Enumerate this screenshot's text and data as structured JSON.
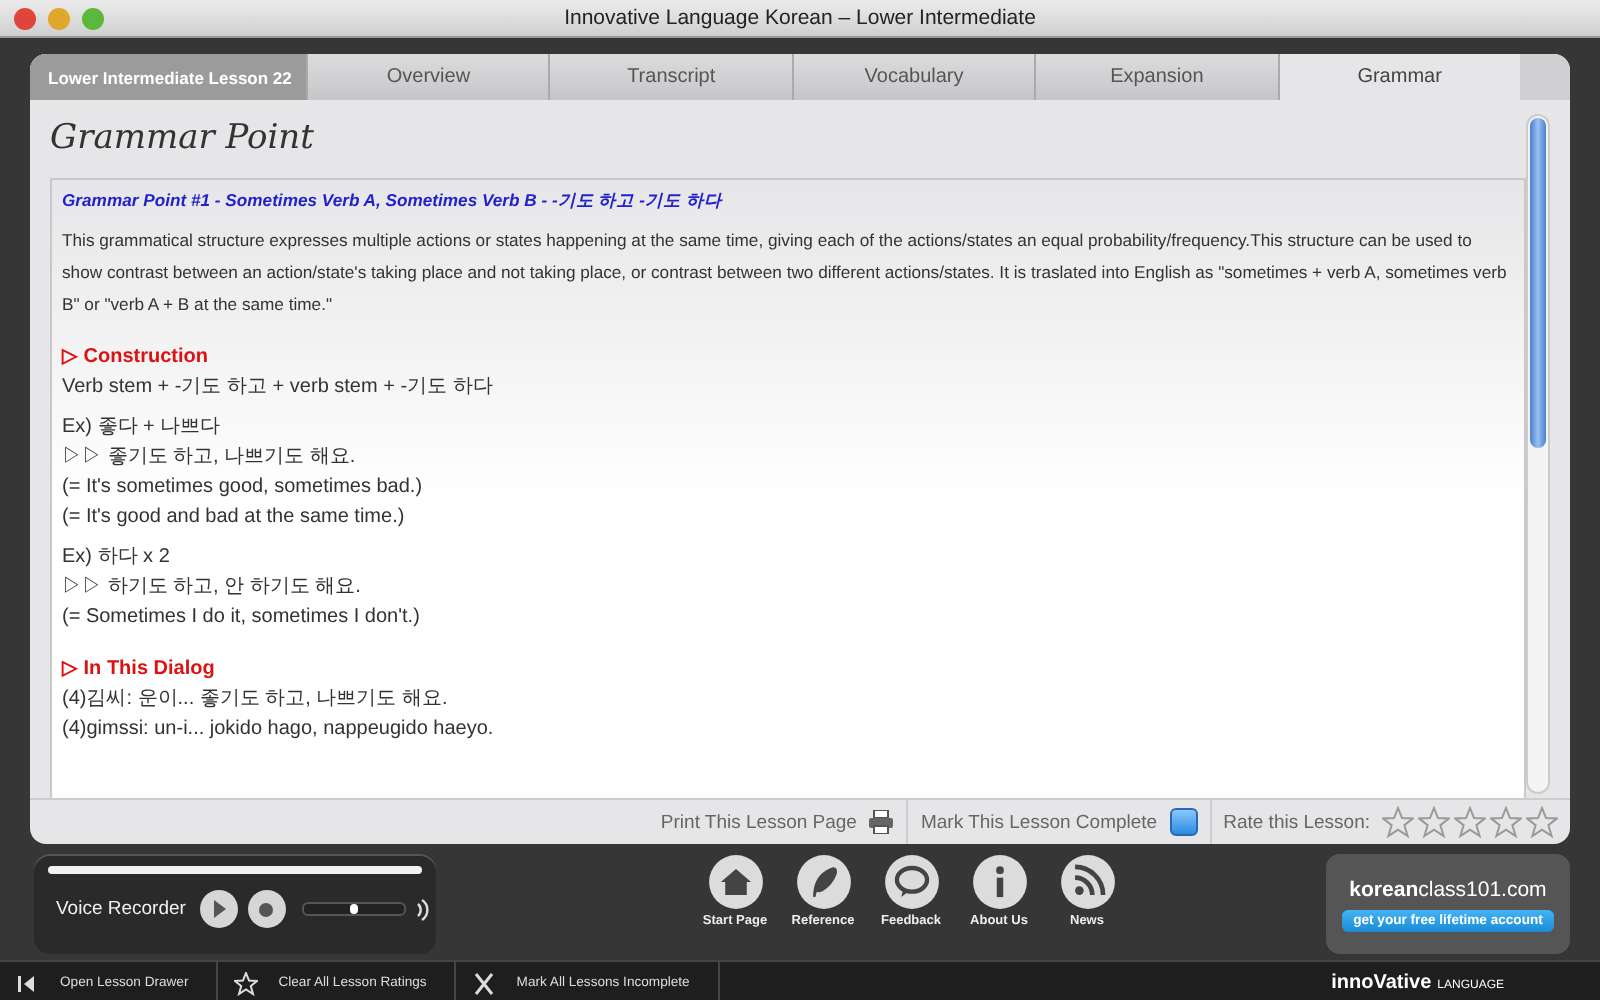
{
  "window": {
    "title": "Innovative Language Korean – Lower Intermediate"
  },
  "lesson_label": "Lower Intermediate Lesson 22",
  "tabs": [
    {
      "label": "Overview",
      "selected": false
    },
    {
      "label": "Transcript",
      "selected": false
    },
    {
      "label": "Vocabulary",
      "selected": false
    },
    {
      "label": "Expansion",
      "selected": false
    },
    {
      "label": "Grammar",
      "selected": true
    }
  ],
  "page_heading": "Grammar Point",
  "blocks": [
    {
      "kind": "title",
      "lines": [
        "Grammar Point #1 - Sometimes Verb A, Sometimes Verb B - -기도 하고 -기도 하다"
      ]
    },
    {
      "kind": "paragraph",
      "lines": [
        "This grammatical structure expresses multiple actions or states happening at the same time, giving each of the actions/states an equal probability/frequency.This structure can be used to show contrast between an action/state's taking place and not taking place, or contrast between two different actions/states. It is traslated into English as \"sometimes + verb A, sometimes verb B\" or \"verb A + B at the same time.\""
      ]
    },
    {
      "kind": "heading",
      "lines": [
        "▷ Construction"
      ]
    },
    {
      "kind": "lines",
      "lines": [
        "Verb stem + -기도 하고 + verb stem + -기도 하다"
      ]
    },
    {
      "kind": "lines",
      "lines": [
        "Ex) 좋다 + 나쁘다",
        "▷▷ 좋기도 하고, 나쁘기도 해요.",
        "(= It's sometimes good, sometimes bad.)",
        "(= It's good and bad at the same time.)"
      ]
    },
    {
      "kind": "lines",
      "lines": [
        "Ex) 하다 x 2",
        "▷▷ 하기도 하고, 안 하기도 해요.",
        "(= Sometimes I do it, sometimes I don't.)"
      ]
    },
    {
      "kind": "heading",
      "lines": [
        "▷ In This Dialog"
      ]
    },
    {
      "kind": "lines",
      "lines": [
        "(4)김씨: 운이... 좋기도 하고, 나쁘기도 해요.",
        "(4)gimssi: un-i... jokido hago, nappeugido haeyo."
      ]
    }
  ],
  "footer": {
    "print": "Print This Lesson Page",
    "complete": {
      "label": "Mark This Lesson Complete",
      "checked": true
    },
    "rating": {
      "label": "Rate this Lesson:",
      "stars": 0
    }
  },
  "recorder": {
    "label": "Voice Recorder",
    "level": 0.5
  },
  "nav": [
    {
      "kind": "home",
      "label": "Start Page"
    },
    {
      "kind": "feather",
      "label": "Reference"
    },
    {
      "kind": "speech",
      "label": "Feedback"
    },
    {
      "kind": "info",
      "label": "About Us"
    },
    {
      "kind": "rss",
      "label": "News"
    }
  ],
  "promo": {
    "site": "**korean**class101.com",
    "button": "get your free lifetime account"
  },
  "status_bar": {
    "items": [
      {
        "kind": "drawer",
        "label": "Open Lesson Drawer"
      },
      {
        "kind": "star",
        "label": "Clear All Lesson Ratings"
      },
      {
        "kind": "cross",
        "label": "Mark All Lessons Incomplete"
      }
    ],
    "logo": {
      "name": "innoVative",
      "tag": "LANGUAGE"
    }
  }
}
